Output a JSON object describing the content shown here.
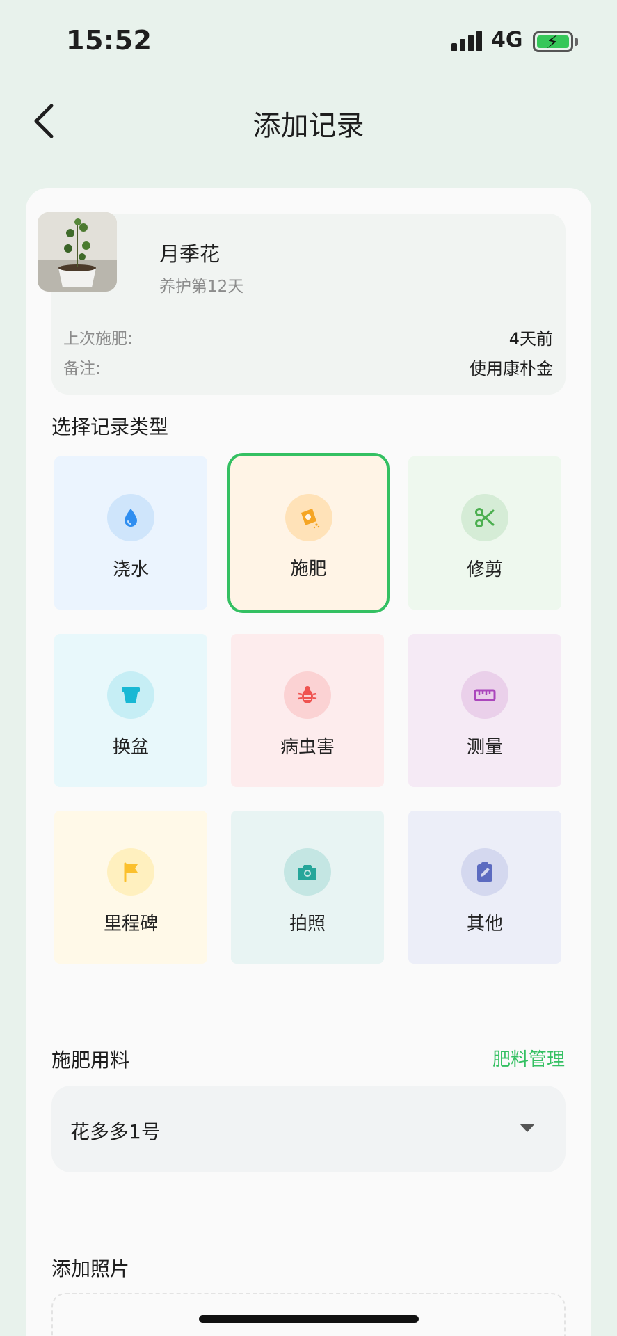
{
  "status_bar": {
    "time": "15:52",
    "network": "4G"
  },
  "header": {
    "title": "添加记录"
  },
  "plant": {
    "name": "月季花",
    "care_days": "养护第12天",
    "last_fertilize_label": "上次施肥:",
    "last_fertilize_value": "4天前",
    "note_label": "备注:",
    "note_value": "使用康朴金"
  },
  "record_type_section": {
    "title": "选择记录类型",
    "selected": "施肥",
    "types": [
      {
        "label": "浇水",
        "icon": "water-drop-icon",
        "bg": "#ebf4fe",
        "icon_bg": "#cfe5fb",
        "color": "#2f8ef0"
      },
      {
        "label": "施肥",
        "icon": "fertilizer-bag-icon",
        "bg": "#fff4e6",
        "icon_bg": "#ffe2b8",
        "color": "#f5a524"
      },
      {
        "label": "修剪",
        "icon": "scissors-icon",
        "bg": "#eef8ee",
        "icon_bg": "#d5ecd6",
        "color": "#4caf50"
      },
      {
        "label": "换盆",
        "icon": "pot-icon",
        "bg": "#e8f8fb",
        "icon_bg": "#c6eef5",
        "color": "#19b8d4"
      },
      {
        "label": "病虫害",
        "icon": "bug-icon",
        "bg": "#fdeced",
        "icon_bg": "#fbd2d3",
        "color": "#ef5350"
      },
      {
        "label": "测量",
        "icon": "ruler-icon",
        "bg": "#f5eaf5",
        "icon_bg": "#ead0ea",
        "color": "#ab47bc"
      },
      {
        "label": "里程碑",
        "icon": "flag-icon",
        "bg": "#fff9e8",
        "icon_bg": "#fff0bf",
        "color": "#fbc02d"
      },
      {
        "label": "拍照",
        "icon": "camera-icon",
        "bg": "#e8f4f3",
        "icon_bg": "#c4e6e3",
        "color": "#26a69a"
      },
      {
        "label": "其他",
        "icon": "edit-clipboard-icon",
        "bg": "#eceef8",
        "icon_bg": "#d4d8ef",
        "color": "#5c6bc0"
      }
    ]
  },
  "fertilizer_section": {
    "title": "施肥用料",
    "manage_link": "肥料管理",
    "selected_value": "花多多1号"
  },
  "photo_section": {
    "title": "添加照片"
  },
  "colors": {
    "accent": "#34c062",
    "background": "#e8f2ec"
  }
}
